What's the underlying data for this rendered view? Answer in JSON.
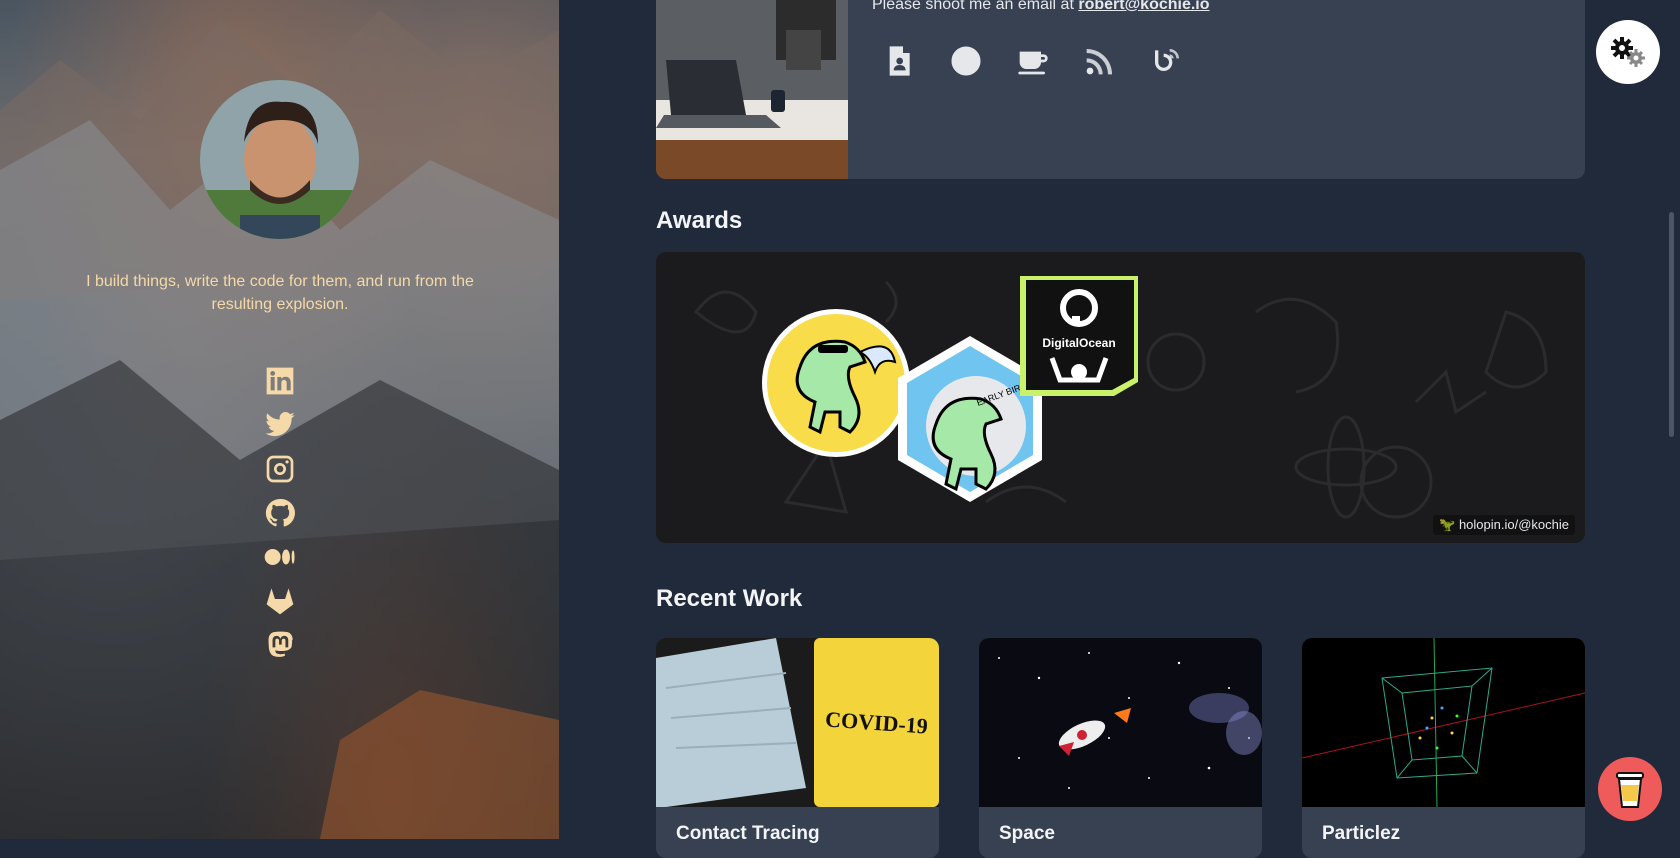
{
  "profile": {
    "tagline": "I build things, write the code for them, and run from the resulting explosion.",
    "social_links": [
      "linkedin-icon",
      "twitter-icon",
      "instagram-icon",
      "github-icon",
      "medium-icon",
      "gitlab-icon",
      "mastodon-icon"
    ]
  },
  "contact": {
    "email_prefix": "Please shoot me an email at",
    "email": "robert@kochie.io",
    "icons": [
      "resume-icon",
      "openai-icon",
      "coffee-cup-icon",
      "rss-icon",
      "bluesky-rss-icon"
    ]
  },
  "awards": {
    "heading": "Awards",
    "badge_text": "DigitalOcean",
    "hex_badge_text": "EARLY BIRD",
    "holopin_link": "🦖 holopin.io/@kochie"
  },
  "recent_work": {
    "heading": "Recent Work",
    "items": [
      {
        "title": "Contact Tracing",
        "thumb_text": "COVID-19"
      },
      {
        "title": "Space"
      },
      {
        "title": "Particlez"
      }
    ]
  },
  "colors": {
    "accent": "#f5d9a8",
    "background": "#212a3b",
    "card": "#374151",
    "coffee": "#ef5a5a"
  }
}
